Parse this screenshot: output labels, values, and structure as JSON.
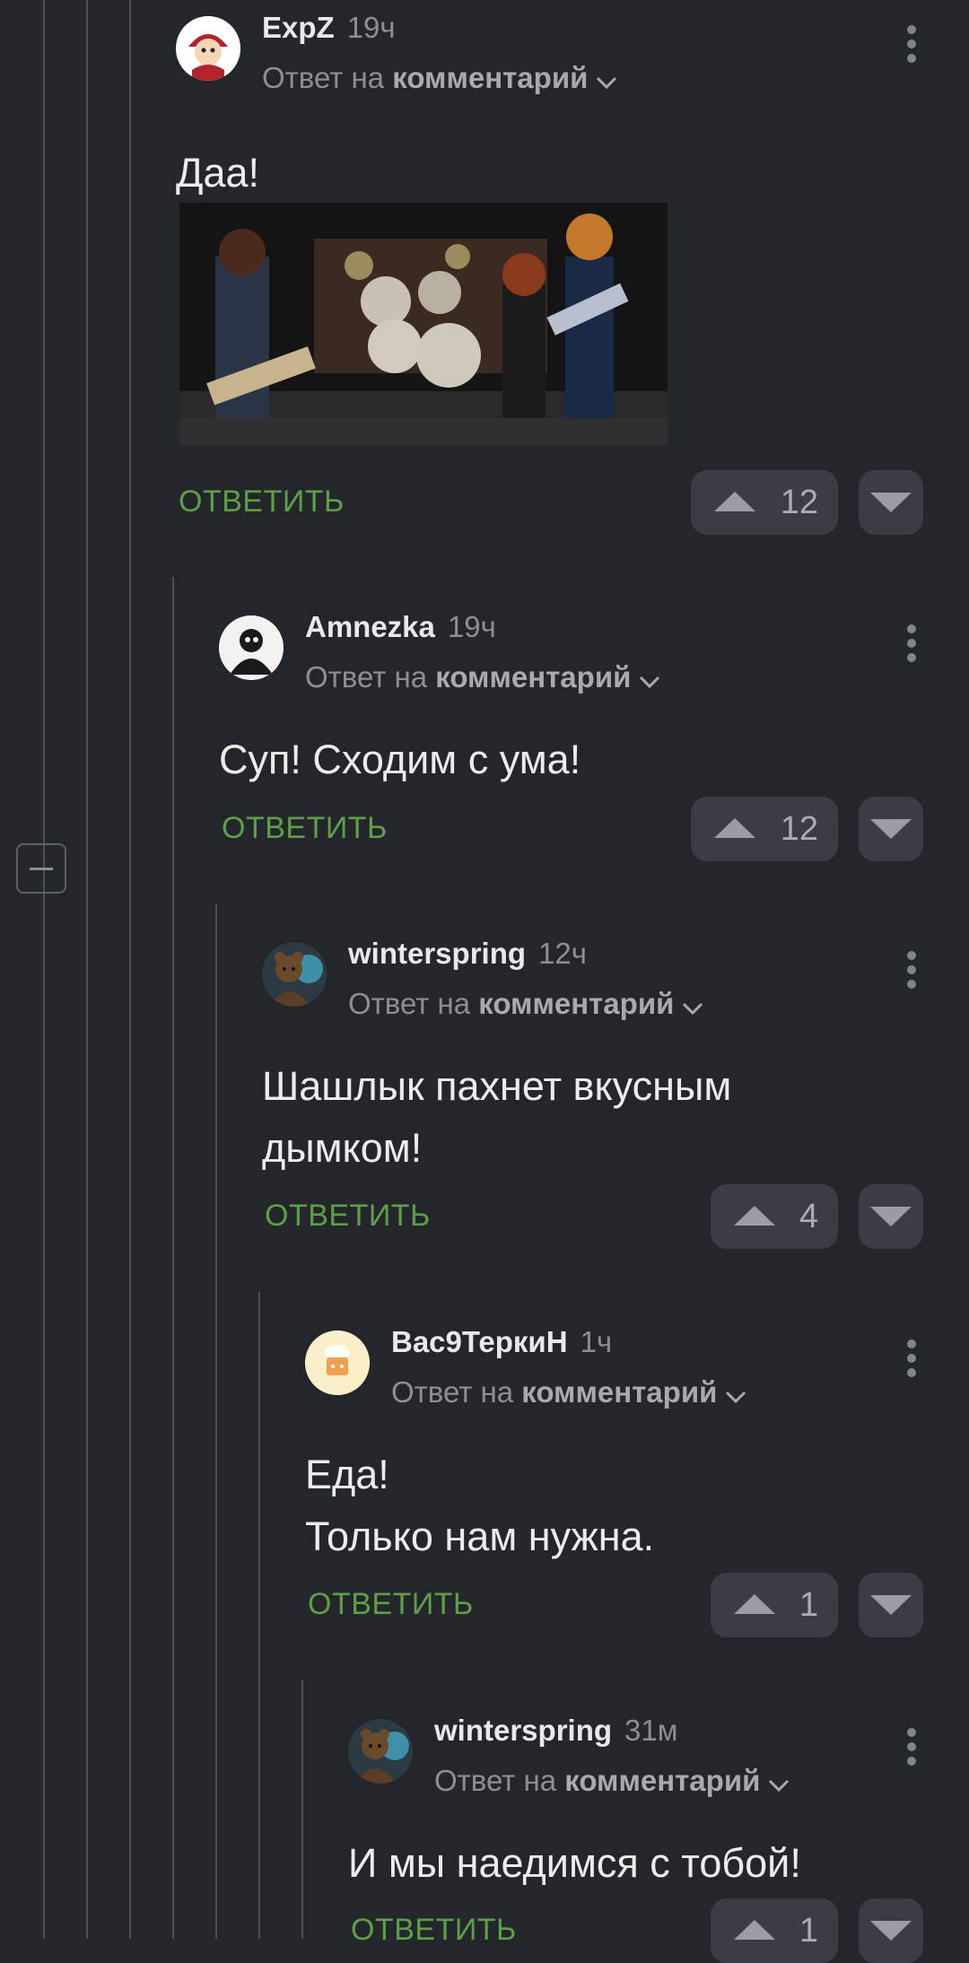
{
  "colors": {
    "background": "#23272c",
    "reply_green": "#5f9e47",
    "thread_line": "#4b5056"
  },
  "comments": [
    {
      "author": "ExpZ",
      "time": "19ч",
      "reply_prefix": "Ответ на",
      "reply_target": "комментарий",
      "text": "Даа!",
      "reply_label": "ОТВЕТИТЬ",
      "score": "12",
      "avatar": "cartoon-avatar-icon"
    },
    {
      "author": "Amnezka",
      "time": "19ч",
      "reply_prefix": "Ответ на",
      "reply_target": "комментарий",
      "text": "Суп! Сходим с ума!",
      "reply_label": "ОТВЕТИТЬ",
      "score": "12",
      "avatar": "monochrome-avatar-icon"
    },
    {
      "author": "winterspring",
      "time": "12ч",
      "reply_prefix": "Ответ на",
      "reply_target": "комментарий",
      "text": "Шашлык пахнет вкусным\nдымком!",
      "reply_label": "ОТВЕТИТЬ",
      "score": "4",
      "avatar": "bear-avatar-icon"
    },
    {
      "author": "Вас9ТеркиН",
      "time": "1ч",
      "reply_prefix": "Ответ на",
      "reply_target": "комментарий",
      "text": "Еда!\nТолько нам нужна.",
      "reply_label": "ОТВЕТИТЬ",
      "score": "1",
      "avatar": "chef-avatar-icon"
    },
    {
      "author": "winterspring",
      "time": "31м",
      "reply_prefix": "Ответ на",
      "reply_target": "комментарий",
      "text": "И мы наедимся с тобой!",
      "reply_label": "ОТВЕТИТЬ",
      "score": "1",
      "avatar": "bear-avatar-icon"
    }
  ]
}
